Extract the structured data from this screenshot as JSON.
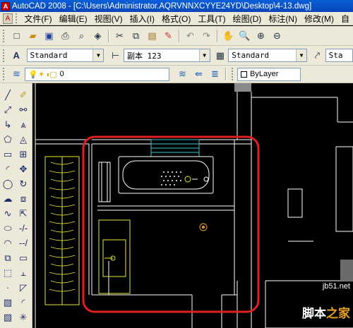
{
  "window": {
    "title": "AutoCAD 2008 - [C:\\Users\\Administrator.AQRVNNXCYYE24YD\\Desktop\\4-13.dwg]"
  },
  "menu": [
    "文件(F)",
    "编辑(E)",
    "视图(V)",
    "插入(I)",
    "格式(O)",
    "工具(T)",
    "绘图(D)",
    "标注(N)",
    "修改(M)",
    "自"
  ],
  "styles": {
    "text_style": "Standard",
    "dim_style": "副本 123",
    "table_style": "Standard",
    "multileader_style": "Sta"
  },
  "layers": {
    "current_layer": "0",
    "color": "ByLayer"
  },
  "icons": {
    "title": "autocad-app-icon",
    "toolbar1": [
      "new-icon",
      "open-icon",
      "save-icon",
      "plot-icon",
      "plot-preview-icon",
      "publish-icon",
      "cut-icon",
      "copy-icon",
      "paste-icon",
      "match-properties-icon",
      "undo-icon",
      "redo-icon",
      "pan-icon",
      "zoom-realtime-icon",
      "zoom-window-icon",
      "zoom-previous-icon"
    ],
    "draw": [
      "line-icon",
      "construction-line-icon",
      "polyline-icon",
      "polygon-icon",
      "rectangle-icon",
      "arc-icon",
      "circle-icon",
      "revision-cloud-icon",
      "spline-icon",
      "ellipse-icon",
      "ellipse-arc-icon",
      "insert-block-icon",
      "make-block-icon",
      "point-icon",
      "hatch-icon",
      "gradient-icon"
    ],
    "modify": [
      "erase-icon",
      "copy-object-icon",
      "mirror-icon",
      "offset-icon",
      "array-icon",
      "move-icon",
      "rotate-icon",
      "scale-icon",
      "stretch-icon",
      "trim-icon",
      "extend-icon",
      "break-icon",
      "join-icon",
      "chamfer-icon",
      "fillet-icon",
      "explode-icon"
    ]
  },
  "watermark": {
    "site": "jb51.net",
    "brand_a": "脚本",
    "brand_b": "之家"
  },
  "colors": {
    "highlight": "#e02020",
    "drawing_white": "#ffffff",
    "fixture_yellow": "#e8e830",
    "window_cyan": "#30c8d0",
    "background": "#000000"
  }
}
